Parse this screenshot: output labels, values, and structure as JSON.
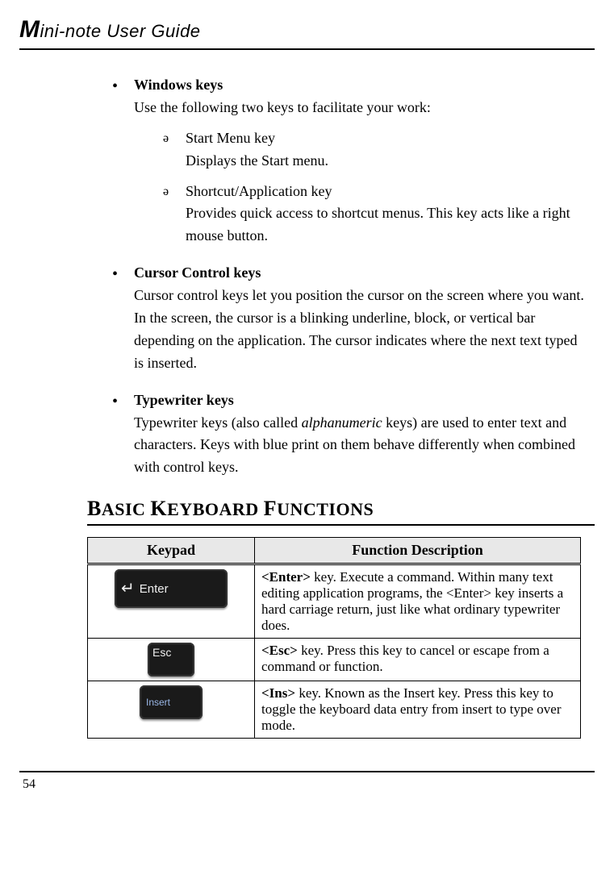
{
  "header": {
    "title_big": "M",
    "title_rest": "ini-note User Guide"
  },
  "bullets": [
    {
      "heading": "Windows keys",
      "body": "Use the following two keys to facilitate your work:",
      "subs": [
        {
          "line1": "Start Menu key",
          "line2": "Displays the Start menu."
        },
        {
          "line1": "Shortcut/Application key",
          "line2": "Provides quick access to shortcut menus. This key acts like a right mouse button."
        }
      ]
    },
    {
      "heading": "Cursor Control keys",
      "body": "Cursor control keys let you position the cursor on the screen where you want. In the screen, the cursor is a blinking underline, block, or vertical bar depending on the application. The cursor indicates where the next text typed is inserted."
    },
    {
      "heading": "Typewriter keys",
      "body_pre": "Typewriter keys (also called ",
      "body_italic": "alphanumeric",
      "body_post": " keys) are used to enter text and characters. Keys with blue print on them behave differently when combined with control keys."
    }
  ],
  "section_title": "BASIC KEYBOARD FUNCTIONS",
  "table": {
    "headers": [
      "Keypad",
      "Function Description"
    ],
    "rows": [
      {
        "key_label": "Enter",
        "key_type": "enter",
        "desc_bold": "<Enter>",
        "desc_rest": " key. Execute a command. Within many text editing application programs, the <Enter> key inserts a hard carriage return, just like what ordinary typewriter does."
      },
      {
        "key_label": "Esc",
        "key_type": "esc",
        "desc_bold": "<Esc>",
        "desc_rest": " key. Press this key to cancel or escape from a command or function."
      },
      {
        "key_label": "Insert",
        "key_type": "insert",
        "desc_bold": "<Ins>",
        "desc_rest": " key. Known as the Insert key. Press this key to toggle the keyboard data entry from insert to type over mode."
      }
    ]
  },
  "page_number": "54"
}
